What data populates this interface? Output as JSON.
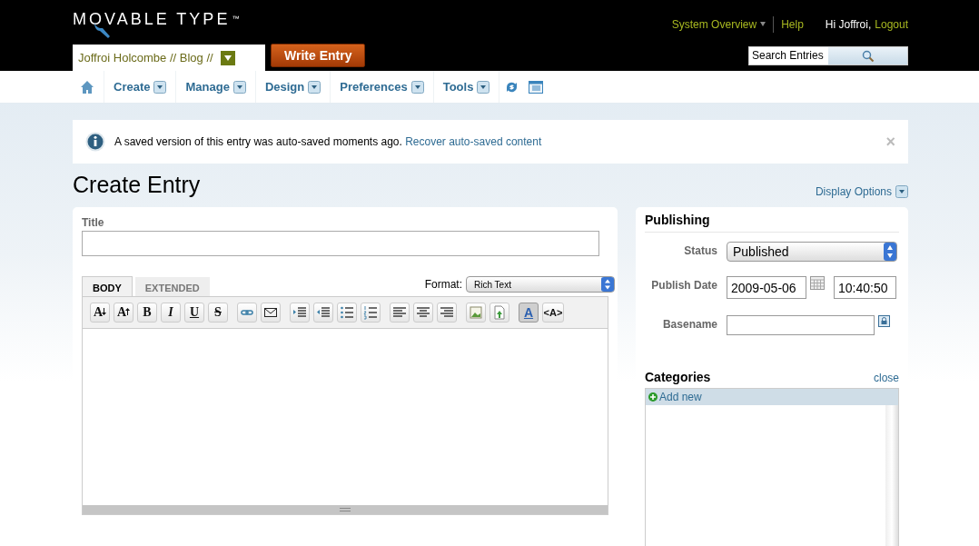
{
  "header": {
    "logo": "MOVABLE TYPE",
    "logo_mark": "™",
    "system_overview": "System Overview",
    "help": "Help",
    "greeting": "Hi Joffroi,",
    "logout": "Logout",
    "blog": "Joffroi Holcombe // Blog //",
    "write_entry": "Write Entry",
    "search": {
      "value": "Search Entries"
    }
  },
  "nav": [
    {
      "kind": "home"
    },
    {
      "kind": "menu",
      "label": "Create"
    },
    {
      "kind": "menu",
      "label": "Manage"
    },
    {
      "kind": "menu",
      "label": "Design"
    },
    {
      "kind": "menu",
      "label": "Preferences"
    },
    {
      "kind": "menu",
      "label": "Tools"
    },
    {
      "kind": "refresh"
    },
    {
      "kind": "view"
    }
  ],
  "notice": {
    "text": "A saved version of this entry was auto-saved moments ago.",
    "link": "Recover auto-saved content",
    "close": "×"
  },
  "page_title": "Create Entry",
  "display_options": "Display Options",
  "editor": {
    "title_label": "Title",
    "tabs": [
      {
        "label": "BODY",
        "selected": true
      },
      {
        "label": "EXTENDED",
        "selected": false
      }
    ],
    "format_label": "Format:",
    "format_value": "Rich Text",
    "toolbar": [
      [
        {
          "kind": "font-down",
          "glyph": "A",
          "pressed": false
        },
        {
          "kind": "font-up",
          "glyph": "A",
          "pressed": false
        },
        {
          "kind": "text",
          "glyph": "B",
          "pressed": false
        },
        {
          "kind": "text",
          "glyph": "I",
          "pressed": false
        },
        {
          "kind": "text",
          "glyph": "U",
          "pressed": false
        },
        {
          "kind": "text",
          "glyph": "S",
          "pressed": false
        }
      ],
      [
        {
          "kind": "link",
          "pressed": false
        },
        {
          "kind": "email",
          "pressed": false
        }
      ],
      [
        {
          "kind": "indent",
          "pressed": false
        },
        {
          "kind": "outdent",
          "pressed": false
        },
        {
          "kind": "bullets",
          "pressed": false
        },
        {
          "kind": "numbers",
          "pressed": false
        }
      ],
      [
        {
          "kind": "align-left",
          "pressed": false
        },
        {
          "kind": "align-center",
          "pressed": false
        },
        {
          "kind": "align-right",
          "pressed": false
        }
      ],
      [
        {
          "kind": "image",
          "pressed": false
        },
        {
          "kind": "file",
          "pressed": false
        }
      ],
      [
        {
          "kind": "text",
          "glyph": "A",
          "pressed": true
        },
        {
          "kind": "text",
          "glyph": "<A>",
          "pressed": false
        }
      ]
    ]
  },
  "publishing": {
    "title": "Publishing",
    "status_label": "Status",
    "status_value": "Published",
    "date_label": "Publish Date",
    "date": "2009-05-06",
    "time": "10:40:50",
    "basename_label": "Basename"
  },
  "categories": {
    "title": "Categories",
    "close": "close",
    "add_new": "Add new"
  }
}
